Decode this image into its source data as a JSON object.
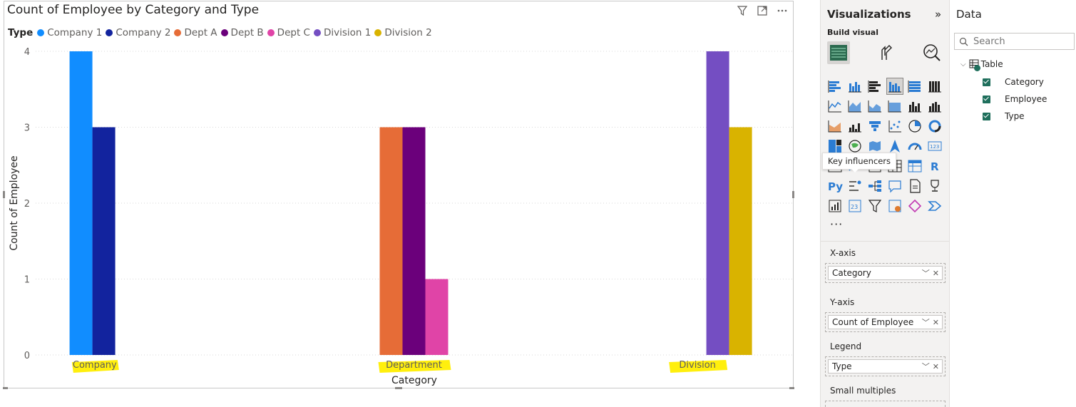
{
  "visual": {
    "title": "Count of Employee by Category and Type",
    "legend_title": "Type",
    "header_icons": [
      "filter-icon",
      "focus-mode-icon",
      "more-options-icon"
    ]
  },
  "chart_data": {
    "type": "bar",
    "title": "Count of Employee by Category and Type",
    "xlabel": "Category",
    "ylabel": "Count of Employee",
    "ylim": [
      0,
      4
    ],
    "yticks": [
      "0",
      "1",
      "2",
      "3",
      "4"
    ],
    "grid": true,
    "legend_title": "Type",
    "legend_position": "top-left",
    "categories": [
      "Company",
      "Department",
      "Division"
    ],
    "series": [
      {
        "name": "Company 1",
        "color": "#118dff",
        "values": [
          4,
          null,
          null
        ]
      },
      {
        "name": "Company 2",
        "color": "#12239e",
        "values": [
          3,
          null,
          null
        ]
      },
      {
        "name": "Dept A",
        "color": "#e66c37",
        "values": [
          null,
          3,
          null
        ]
      },
      {
        "name": "Dept B",
        "color": "#6b007b",
        "values": [
          null,
          3,
          null
        ]
      },
      {
        "name": "Dept C",
        "color": "#e044a7",
        "values": [
          null,
          1,
          null
        ]
      },
      {
        "name": "Division 1",
        "color": "#744ec2",
        "values": [
          null,
          null,
          4
        ]
      },
      {
        "name": "Division 2",
        "color": "#d9b300",
        "values": [
          null,
          null,
          3
        ]
      }
    ],
    "highlight_color": "#ffee00"
  },
  "viz_pane": {
    "title": "Visualizations",
    "build_visual": "Build visual",
    "tooltip": "Key influencers",
    "more": "···",
    "selected_color": "#4a6fa5",
    "wells": [
      {
        "label": "X-axis",
        "field": "Category"
      },
      {
        "label": "Y-axis",
        "field": "Count of Employee"
      },
      {
        "label": "Legend",
        "field": "Type"
      },
      {
        "label": "Small multiples",
        "field": ""
      }
    ]
  },
  "data_pane": {
    "title": "Data",
    "search_placeholder": "Search",
    "table_name": "Table",
    "fields": [
      "Category",
      "Employee",
      "Type"
    ]
  }
}
